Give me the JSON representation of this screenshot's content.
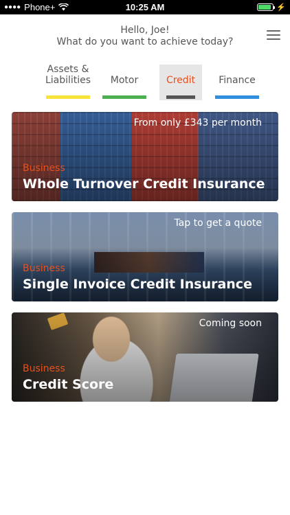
{
  "status_bar": {
    "carrier": "Phone+",
    "time": "10:25 AM"
  },
  "header": {
    "greeting_line1": "Hello, Joe!",
    "greeting_line2": "What do you want to achieve today?"
  },
  "tabs": [
    {
      "label_line1": "Assets &",
      "label_line2": "Liabilities",
      "color": "#f7e43a",
      "active": false
    },
    {
      "label_line1": "Motor",
      "label_line2": "",
      "color": "#4caf50",
      "active": false
    },
    {
      "label_line1": "Credit",
      "label_line2": "",
      "color": "#555555",
      "active": true
    },
    {
      "label_line1": "Finance",
      "label_line2": "",
      "color": "#2f8fdc",
      "active": false
    }
  ],
  "cards": [
    {
      "tagline": "From only £343 per month",
      "category": "Business",
      "title": "Whole Turnover Credit Insurance"
    },
    {
      "tagline": "Tap to get a quote",
      "category": "Business",
      "title": "Single Invoice Credit Insurance"
    },
    {
      "tagline": "Coming soon",
      "category": "Business",
      "title": "Credit Score"
    }
  ],
  "colors": {
    "accent": "#e8501e"
  }
}
